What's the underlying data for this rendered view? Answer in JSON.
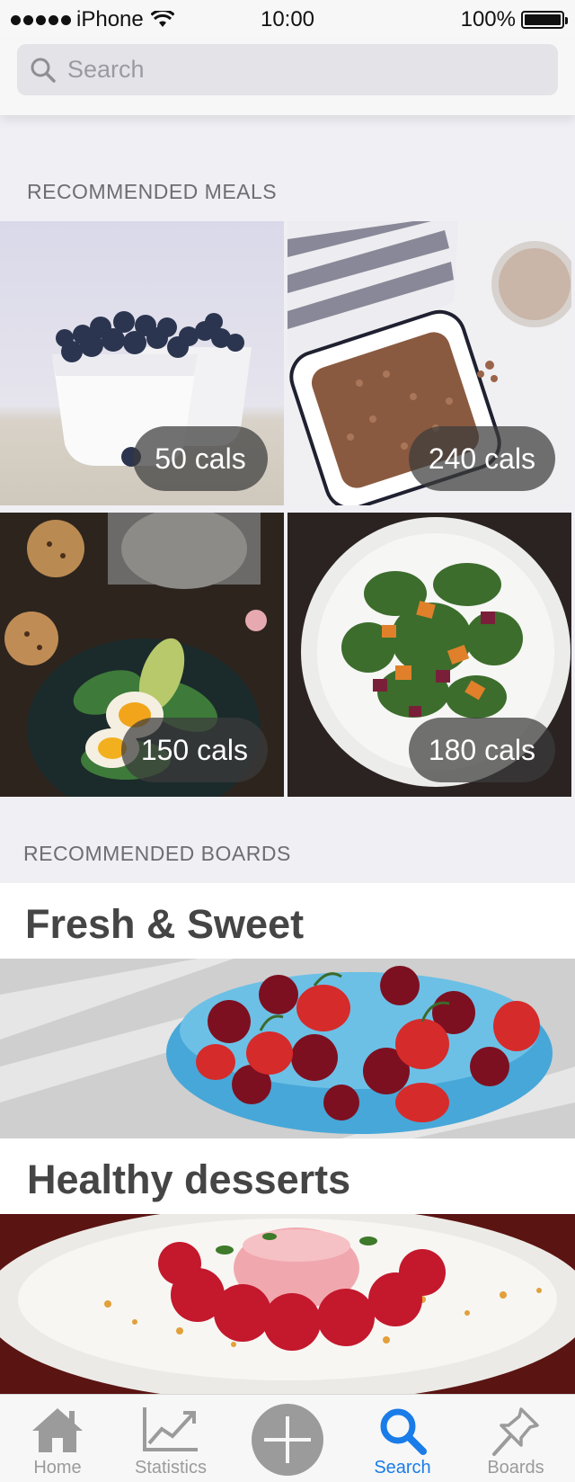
{
  "status_bar": {
    "carrier": "iPhone",
    "time": "10:00",
    "battery": "100%"
  },
  "search": {
    "placeholder": "Search"
  },
  "sections": {
    "meals_header": "RECOMMENDED MEALS",
    "boards_header": "RECOMMENDED BOARDS"
  },
  "meals": [
    {
      "cals": "50 cals",
      "image": "blueberries-bowl"
    },
    {
      "cals": "240 cals",
      "image": "granola-dish"
    },
    {
      "cals": "150 cals",
      "image": "eggs-avocado-plate"
    },
    {
      "cals": "180 cals",
      "image": "salad-bowl"
    }
  ],
  "boards": [
    {
      "title": "Fresh & Sweet",
      "image": "berries-cherries-bowl"
    },
    {
      "title": "Healthy desserts",
      "image": "raspberry-panna-cotta"
    }
  ],
  "tab_bar": {
    "tabs": [
      {
        "label": "Home",
        "icon": "home-icon",
        "active": false
      },
      {
        "label": "Statistics",
        "icon": "chart-icon",
        "active": false
      },
      {
        "label": "",
        "icon": "add-icon",
        "active": false
      },
      {
        "label": "Search",
        "icon": "search-icon",
        "active": true
      },
      {
        "label": "Boards",
        "icon": "pin-icon",
        "active": false
      }
    ]
  },
  "colors": {
    "accent": "#1a7ce8",
    "inactive": "#9b9b9b",
    "background": "#efeff4"
  }
}
